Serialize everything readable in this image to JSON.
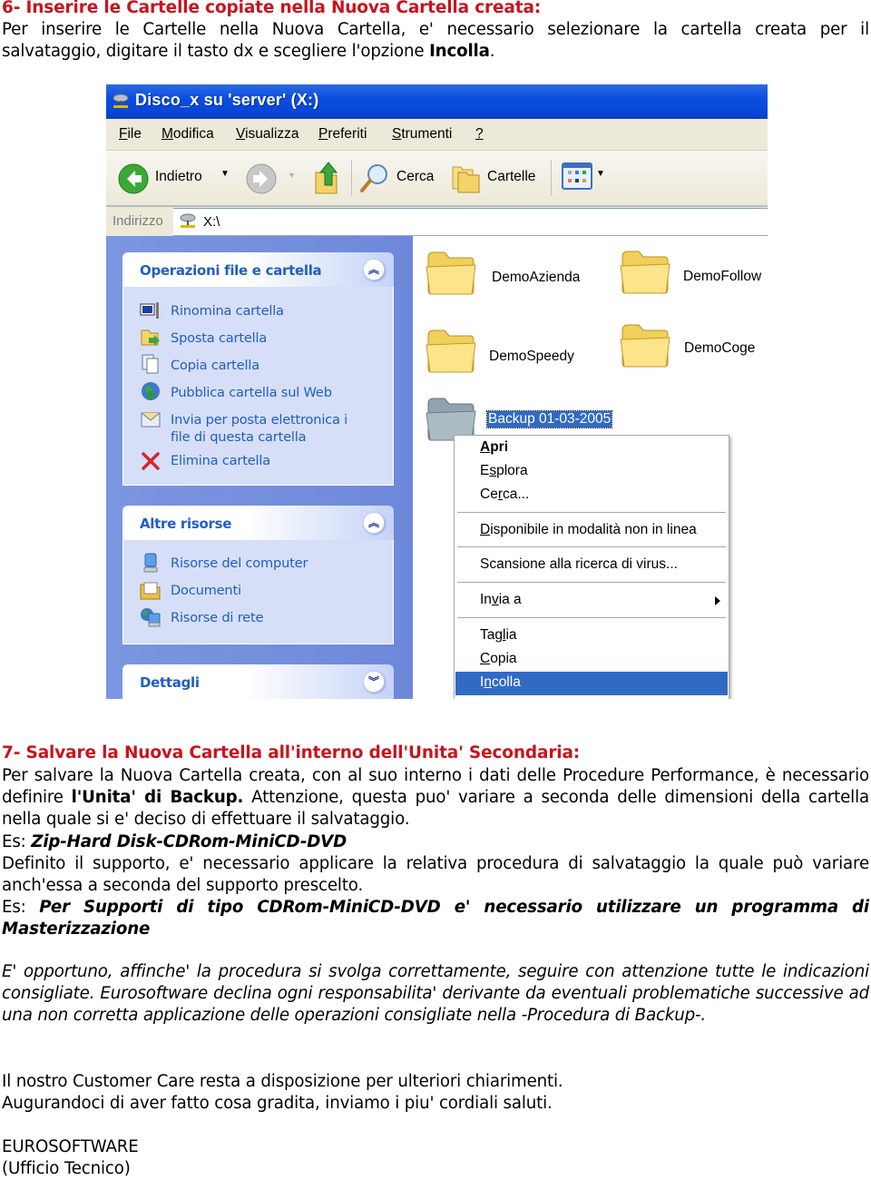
{
  "section6": {
    "heading": "6- Inserire le Cartelle copiate nella Nuova Cartella creata:",
    "para_line1": "Per inserire le Cartelle nella Nuova Cartella, e' necessario selezionare la cartella creata per il",
    "para_line2_pre": "salvataggio, digitare il tasto dx e scegliere l'opzione ",
    "para_line2_bold": "Incolla",
    "para_line2_post": "."
  },
  "explorer": {
    "title": "Disco_x su 'server' (X:)",
    "menu": [
      {
        "u": "F",
        "rest": "ile"
      },
      {
        "u": "M",
        "rest": "odifica"
      },
      {
        "u": "V",
        "rest": "isualizza"
      },
      {
        "u": "P",
        "rest": "referiti"
      },
      {
        "u": "S",
        "rest": "trumenti"
      },
      {
        "u": "?",
        "rest": ""
      }
    ],
    "toolbar": {
      "back": "Indietro",
      "search": "Cerca",
      "folders": "Cartelle"
    },
    "address": {
      "label": "Indirizzo",
      "value": "X:\\"
    },
    "tasks_panel": {
      "title": "Operazioni file e cartella",
      "items": [
        {
          "label": "Rinomina cartella",
          "icon": "rename-icon"
        },
        {
          "label": "Sposta cartella",
          "icon": "move-folder-icon"
        },
        {
          "label": "Copia cartella",
          "icon": "copy-icon"
        },
        {
          "label": "Pubblica cartella sul Web",
          "icon": "publish-web-icon"
        },
        {
          "label": "Invia per posta elettronica i",
          "label2": "file di questa cartella",
          "icon": "email-icon"
        },
        {
          "label": "Elimina cartella",
          "icon": "delete-icon"
        }
      ]
    },
    "other_panel": {
      "title": "Altre risorse",
      "items": [
        {
          "label": "Risorse del computer",
          "icon": "computer-icon"
        },
        {
          "label": "Documenti",
          "icon": "documents-icon"
        },
        {
          "label": "Risorse di rete",
          "icon": "network-icon"
        }
      ]
    },
    "details_panel": {
      "title": "Dettagli"
    },
    "folders": [
      {
        "name": "DemoAzienda"
      },
      {
        "name": "DemoFollow"
      },
      {
        "name": "DemoSpeedy"
      },
      {
        "name": "DemoCoge"
      },
      {
        "name": "Backup 01-03-2005",
        "selected": true
      }
    ],
    "context_menu": {
      "items": [
        {
          "u": "A",
          "rest": "pri",
          "pre": "",
          "bold": true
        },
        {
          "pre": "E",
          "u": "s",
          "rest": "plora"
        },
        {
          "pre": "Ce",
          "u": "r",
          "rest": "ca..."
        },
        {
          "pre": "",
          "u": "D",
          "rest": "isponibile in modalità non in linea"
        },
        {
          "pre": "Scansione alla ricerca di virus...",
          "u": "",
          "rest": ""
        },
        {
          "pre": "In",
          "u": "v",
          "rest": "ia a",
          "submenu": true
        },
        {
          "pre": "Tag",
          "u": "l",
          "rest": "ia"
        },
        {
          "pre": "",
          "u": "C",
          "rest": "opia"
        },
        {
          "pre": "I",
          "u": "n",
          "rest": "colla",
          "highlighted": true
        }
      ]
    },
    "colors": {
      "titlebar": "#0a4ee0",
      "taskpane": "#6d88d9",
      "link": "#215dc6",
      "selection": "#316ac5"
    }
  },
  "section7": {
    "heading": "7- Salvare la Nuova Cartella all'interno dell'Unita' Secondaria:",
    "p1_a": "Per salvare la Nuova Cartella creata, con al suo interno i dati delle Procedure Performance, è necessario definire ",
    "p1_bold": "l'Unita' di Backup.",
    "p1_b": " Attenzione, questa puo' variare a seconda delle dimensioni della cartella nella quale si e' deciso di effettuare il salvataggio.",
    "es1_label": "Es: ",
    "es1_value": "Zip-Hard Disk-CDRom-MiniCD-DVD",
    "p2": "Definito il supporto, e' necessario applicare la relativa procedura di salvataggio la quale può variare anch'essa a seconda del supporto prescelto.",
    "es2_label": "Es: ",
    "es2_value": "Per Supporti di tipo CDRom-MiniCD-DVD e' necessario utilizzare un programma di Masterizzazione",
    "disclaimer": "E' opportuno, affinche' la procedura si svolga correttamente, seguire con attenzione tutte le indicazioni consigliate. Eurosoftware declina ogni responsabilita' derivante da eventuali problematiche successive ad una non corretta applicazione delle operazioni consigliate nella -Procedura di Backup-.",
    "closing1": "Il nostro Customer Care resta a disposizione per ulteriori chiarimenti.",
    "closing2": "Augurandoci di aver fatto cosa gradita, inviamo i piu' cordiali saluti.",
    "sign1": "EUROSOFTWARE",
    "sign2": "(Ufficio Tecnico)"
  }
}
